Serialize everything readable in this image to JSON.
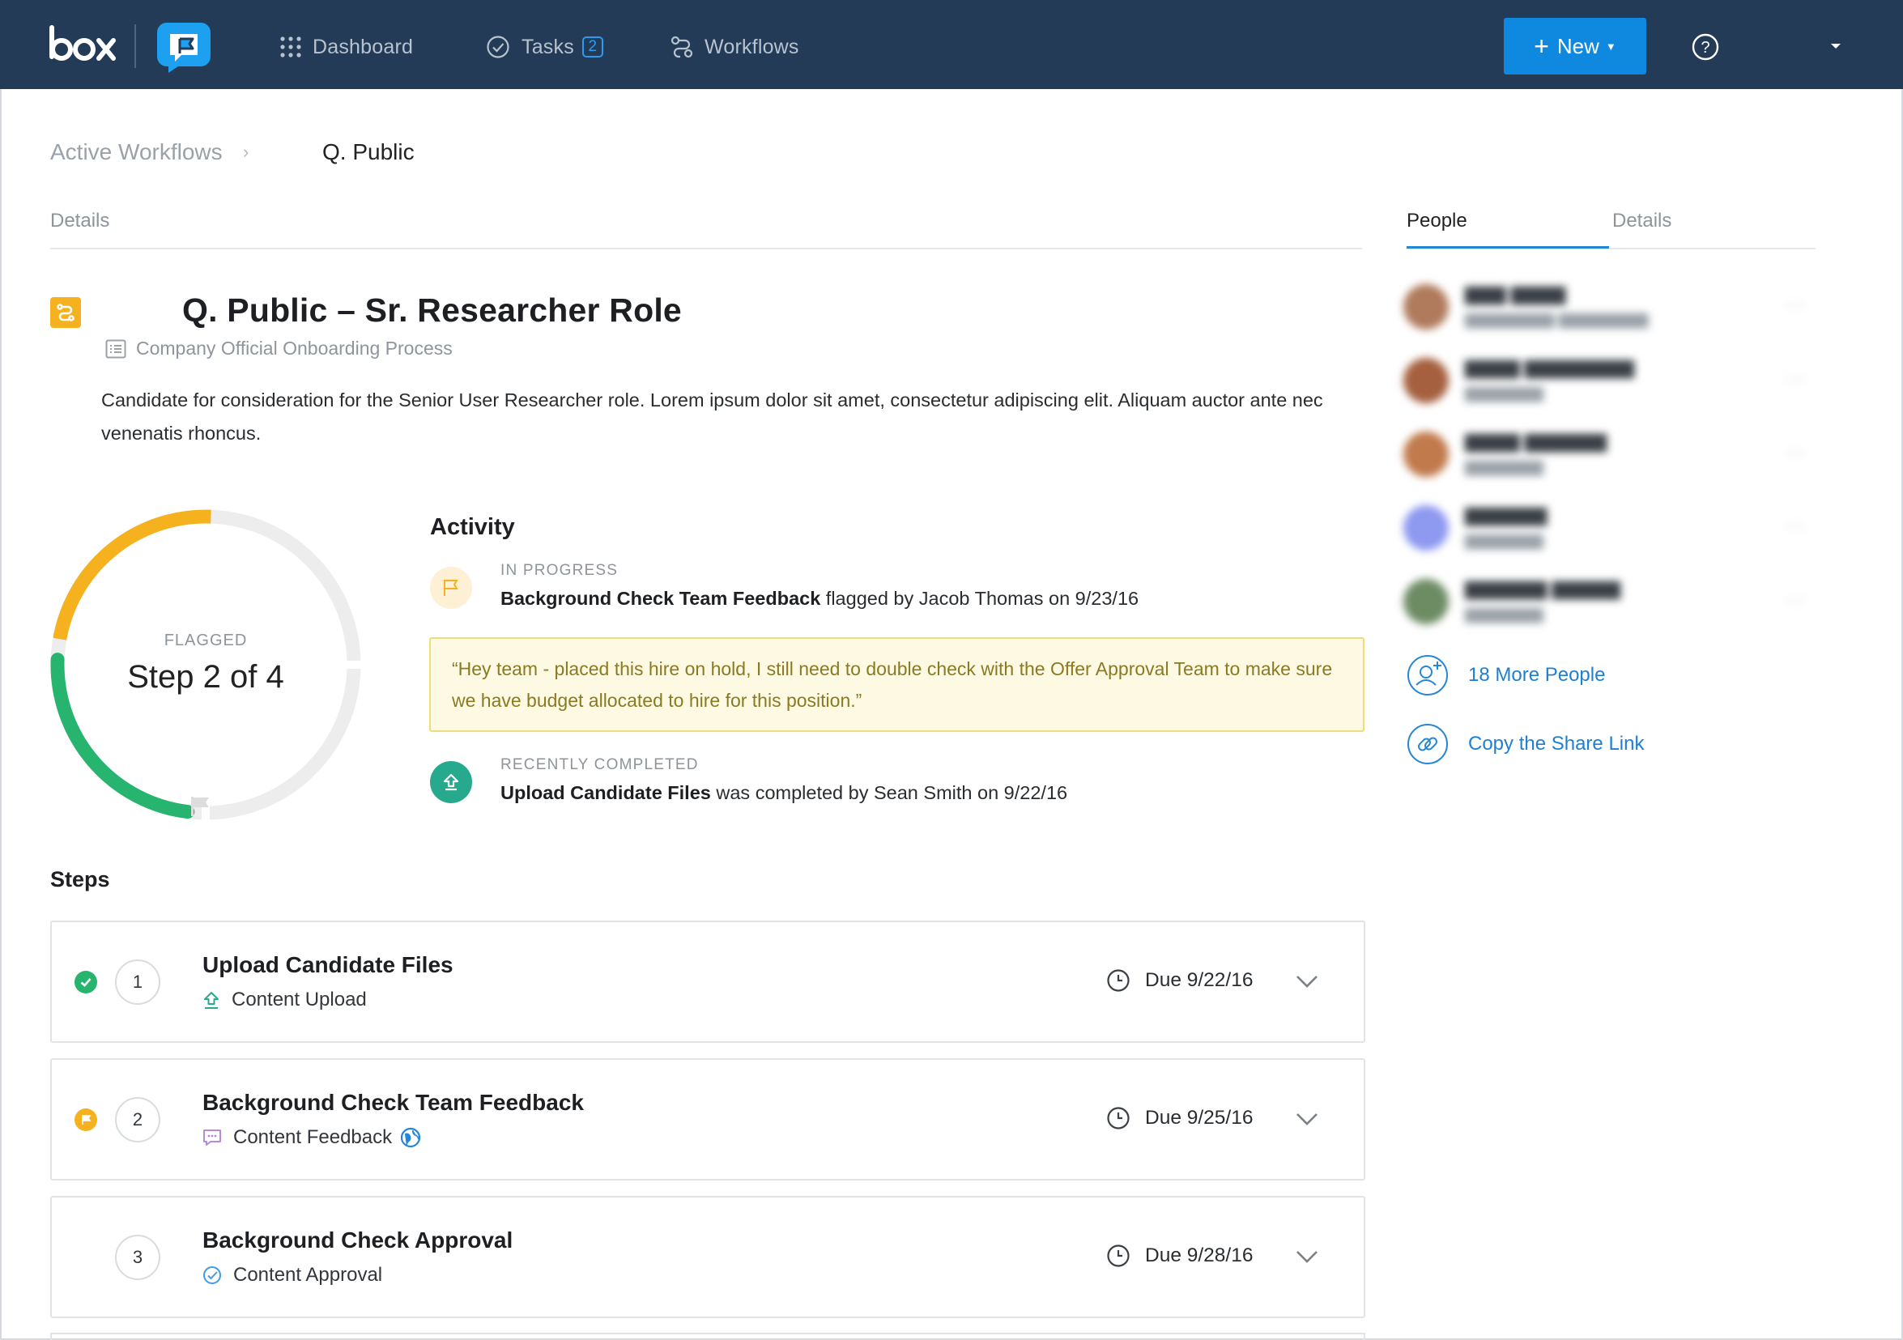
{
  "topbar": {
    "logo_text": "box",
    "nav": [
      {
        "label": "Dashboard",
        "icon": "grid-icon"
      },
      {
        "label": "Tasks",
        "icon": "check-circle-icon",
        "badge": "2"
      },
      {
        "label": "Workflows",
        "icon": "workflow-icon"
      }
    ],
    "new_button": "New",
    "colors": {
      "bar": "#233b57",
      "accent": "#0f89e0"
    }
  },
  "breadcrumb": {
    "root": "Active Workflows",
    "separator": "›",
    "current": "Q. Public"
  },
  "main": {
    "tab_label": "Details",
    "title": "Q. Public – Sr. Researcher Role",
    "subtitle": "Company Official Onboarding Process",
    "description": "Candidate for consideration for the Senior User Researcher role. Lorem ipsum dolor sit amet, consectetur adipiscing elit. Aliquam auctor ante nec venenatis rhoncus."
  },
  "progress": {
    "status": "FLAGGED",
    "step_label": "Step 2 of 4",
    "current_step": 2,
    "total_steps": 4,
    "colors": {
      "completed": "#26b46f",
      "flagged": "#f5b11e",
      "pending": "#ececec"
    }
  },
  "activity": {
    "title": "Activity",
    "items": [
      {
        "status": "IN PROGRESS",
        "step": "Background Check Team Feedback",
        "rest": " flagged by Jacob Thomas on 9/23/16",
        "icon": "flag-icon"
      },
      {
        "status": "RECENTLY COMPLETED",
        "step": "Upload Candidate Files",
        "rest": " was completed by Sean Smith on 9/22/16",
        "icon": "upload-icon"
      }
    ],
    "quote": "“Hey team - placed this hire on hold, I still need to double check with the Offer Approval Team to make sure we have budget allocated to hire for this position.”"
  },
  "steps": {
    "title": "Steps",
    "items": [
      {
        "num": "1",
        "name": "Upload Candidate Files",
        "type": "Content Upload",
        "due": "Due 9/22/16",
        "status": "completed"
      },
      {
        "num": "2",
        "name": "Background Check Team Feedback",
        "type": "Content Feedback",
        "due": "Due 9/25/16",
        "status": "flagged"
      },
      {
        "num": "3",
        "name": "Background Check Approval",
        "type": "Content Approval",
        "due": "Due 9/28/16",
        "status": "pending"
      }
    ]
  },
  "sidebar": {
    "tabs": [
      "People",
      "Details"
    ],
    "active_tab": "People",
    "more_people": "18 More People",
    "share_link": "Copy the Share Link"
  }
}
